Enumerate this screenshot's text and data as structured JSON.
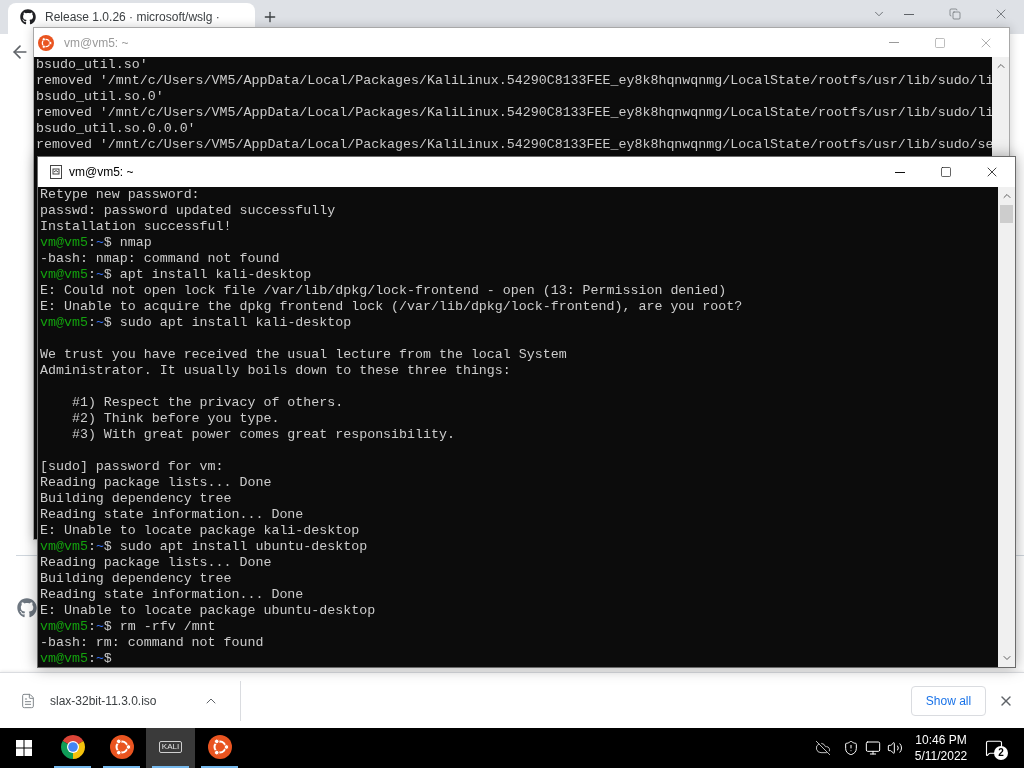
{
  "browser": {
    "tab": {
      "title": "Release 1.0.26 · microsoft/wslg ·",
      "selected": true
    },
    "download_bar": {
      "file_name": "slax-32bit-11.3.0.iso",
      "show_all": "Show all"
    }
  },
  "windows": [
    {
      "title": "vm@vm5: ~",
      "active": false,
      "kind": "ubuntu",
      "lines": [
        {
          "kind": "output",
          "text": "bsudo_util.so'"
        },
        {
          "kind": "output",
          "text": "removed '/mnt/c/Users/VM5/AppData/Local/Packages/KaliLinux.54290C8133FEE_ey8k8hqnwqnmg/LocalState/rootfs/usr/lib/sudo/li"
        },
        {
          "kind": "output",
          "text": "bsudo_util.so.0'"
        },
        {
          "kind": "output",
          "text": "removed '/mnt/c/Users/VM5/AppData/Local/Packages/KaliLinux.54290C8133FEE_ey8k8hqnwqnmg/LocalState/rootfs/usr/lib/sudo/li"
        },
        {
          "kind": "output",
          "text": "bsudo_util.so.0.0.0'"
        },
        {
          "kind": "output",
          "text": "removed '/mnt/c/Users/VM5/AppData/Local/Packages/KaliLinux.54290C8133FEE_ey8k8hqnwqnmg/LocalState/rootfs/usr/lib/sudo/se"
        }
      ]
    },
    {
      "title": "vm@vm5: ~",
      "active": true,
      "kind": "generic",
      "lines": [
        {
          "kind": "output",
          "text": "Retype new password:"
        },
        {
          "kind": "output",
          "text": "passwd: password updated successfully"
        },
        {
          "kind": "output",
          "text": "Installation successful!"
        },
        {
          "kind": "prompt",
          "user": "vm@vm5",
          "separator": ":",
          "path": "~",
          "symbol": "$",
          "command": "nmap"
        },
        {
          "kind": "output",
          "text": "-bash: nmap: command not found"
        },
        {
          "kind": "prompt",
          "user": "vm@vm5",
          "separator": ":",
          "path": "~",
          "symbol": "$",
          "command": "apt install kali-desktop"
        },
        {
          "kind": "output",
          "text": "E: Could not open lock file /var/lib/dpkg/lock-frontend - open (13: Permission denied)"
        },
        {
          "kind": "output",
          "text": "E: Unable to acquire the dpkg frontend lock (/var/lib/dpkg/lock-frontend), are you root?"
        },
        {
          "kind": "prompt",
          "user": "vm@vm5",
          "separator": ":",
          "path": "~",
          "symbol": "$",
          "command": "sudo apt install kali-desktop"
        },
        {
          "kind": "blank"
        },
        {
          "kind": "output",
          "text": "We trust you have received the usual lecture from the local System"
        },
        {
          "kind": "output",
          "text": "Administrator. It usually boils down to these three things:"
        },
        {
          "kind": "blank"
        },
        {
          "kind": "output",
          "text": "    #1) Respect the privacy of others."
        },
        {
          "kind": "output",
          "text": "    #2) Think before you type."
        },
        {
          "kind": "output",
          "text": "    #3) With great power comes great responsibility."
        },
        {
          "kind": "blank"
        },
        {
          "kind": "output",
          "text": "[sudo] password for vm:"
        },
        {
          "kind": "output",
          "text": "Reading package lists... Done"
        },
        {
          "kind": "output",
          "text": "Building dependency tree"
        },
        {
          "kind": "output",
          "text": "Reading state information... Done"
        },
        {
          "kind": "output",
          "text": "E: Unable to locate package kali-desktop"
        },
        {
          "kind": "prompt",
          "user": "vm@vm5",
          "separator": ":",
          "path": "~",
          "symbol": "$",
          "command": "sudo apt install ubuntu-desktop"
        },
        {
          "kind": "output",
          "text": "Reading package lists... Done"
        },
        {
          "kind": "output",
          "text": "Building dependency tree"
        },
        {
          "kind": "output",
          "text": "Reading state information... Done"
        },
        {
          "kind": "output",
          "text": "E: Unable to locate package ubuntu-desktop"
        },
        {
          "kind": "prompt",
          "user": "vm@vm5",
          "separator": ":",
          "path": "~",
          "symbol": "$",
          "command": "rm -rfv /mnt"
        },
        {
          "kind": "output",
          "text": "-bash: rm: command not found"
        },
        {
          "kind": "prompt",
          "user": "vm@vm5",
          "separator": ":",
          "path": "~",
          "symbol": "$"
        }
      ]
    }
  ],
  "taskbar": {
    "apps": [
      {
        "kind": "chrome",
        "selected": false
      },
      {
        "kind": "ubuntu",
        "selected": false
      },
      {
        "kind": "kali",
        "label": "KALI",
        "selected": true
      },
      {
        "kind": "ubuntu",
        "selected": false
      }
    ],
    "time": "10:46 PM",
    "date": "5/11/2022",
    "notifications": "2"
  }
}
